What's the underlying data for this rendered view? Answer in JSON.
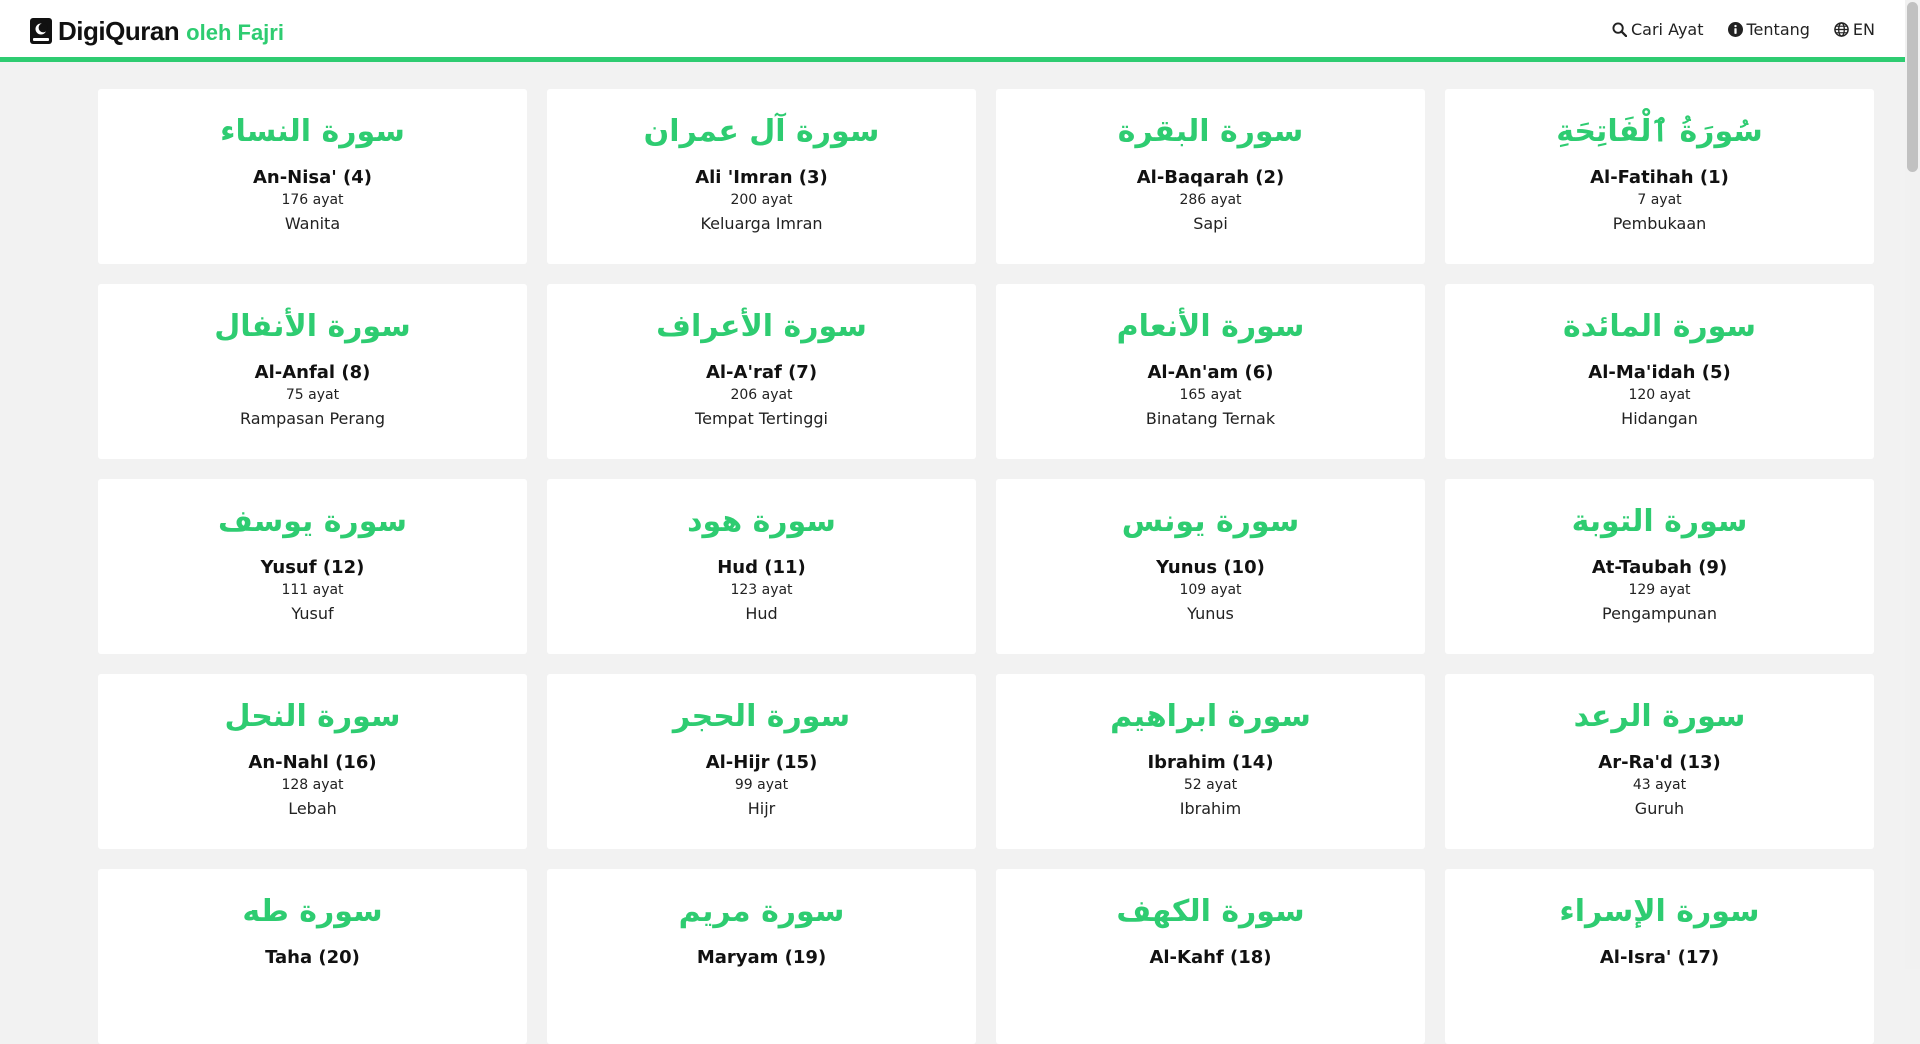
{
  "app": {
    "brand": "DigiQuran",
    "author": "oleh Fajri",
    "accent_color": "#2ecc71"
  },
  "nav": {
    "search_label": "Cari Ayat",
    "about_label": "Tentang",
    "lang_label": "EN"
  },
  "surahs": [
    {
      "arabic": "سورة النساء",
      "name": "An-Nisa' (4)",
      "ayat": "176 ayat",
      "meaning": "Wanita"
    },
    {
      "arabic": "سورة آل عمران",
      "name": "Ali 'Imran (3)",
      "ayat": "200 ayat",
      "meaning": "Keluarga Imran"
    },
    {
      "arabic": "سورة البقرة",
      "name": "Al-Baqarah (2)",
      "ayat": "286 ayat",
      "meaning": "Sapi"
    },
    {
      "arabic": "سُورَةُ ٱلْفَاتِحَةِ",
      "name": "Al-Fatihah (1)",
      "ayat": "7 ayat",
      "meaning": "Pembukaan"
    },
    {
      "arabic": "سورة الأنفال",
      "name": "Al-Anfal (8)",
      "ayat": "75 ayat",
      "meaning": "Rampasan Perang"
    },
    {
      "arabic": "سورة الأعراف",
      "name": "Al-A'raf (7)",
      "ayat": "206 ayat",
      "meaning": "Tempat Tertinggi"
    },
    {
      "arabic": "سورة الأنعام",
      "name": "Al-An'am (6)",
      "ayat": "165 ayat",
      "meaning": "Binatang Ternak"
    },
    {
      "arabic": "سورة المائدة",
      "name": "Al-Ma'idah (5)",
      "ayat": "120 ayat",
      "meaning": "Hidangan"
    },
    {
      "arabic": "سورة يوسف",
      "name": "Yusuf (12)",
      "ayat": "111 ayat",
      "meaning": "Yusuf"
    },
    {
      "arabic": "سورة هود",
      "name": "Hud (11)",
      "ayat": "123 ayat",
      "meaning": "Hud"
    },
    {
      "arabic": "سورة يونس",
      "name": "Yunus (10)",
      "ayat": "109 ayat",
      "meaning": "Yunus"
    },
    {
      "arabic": "سورة التوبة",
      "name": "At-Taubah (9)",
      "ayat": "129 ayat",
      "meaning": "Pengampunan"
    },
    {
      "arabic": "سورة النحل",
      "name": "An-Nahl (16)",
      "ayat": "128 ayat",
      "meaning": "Lebah"
    },
    {
      "arabic": "سورة الحجر",
      "name": "Al-Hijr (15)",
      "ayat": "99 ayat",
      "meaning": "Hijr"
    },
    {
      "arabic": "سورة ابراهيم",
      "name": "Ibrahim (14)",
      "ayat": "52 ayat",
      "meaning": "Ibrahim"
    },
    {
      "arabic": "سورة الرعد",
      "name": "Ar-Ra'd (13)",
      "ayat": "43 ayat",
      "meaning": "Guruh"
    },
    {
      "arabic": "سورة طه",
      "name": "Taha (20)",
      "ayat": "",
      "meaning": ""
    },
    {
      "arabic": "سورة مريم",
      "name": "Maryam (19)",
      "ayat": "",
      "meaning": ""
    },
    {
      "arabic": "سورة الكهف",
      "name": "Al-Kahf (18)",
      "ayat": "",
      "meaning": ""
    },
    {
      "arabic": "سورة الإسراء",
      "name": "Al-Isra' (17)",
      "ayat": "",
      "meaning": ""
    }
  ]
}
